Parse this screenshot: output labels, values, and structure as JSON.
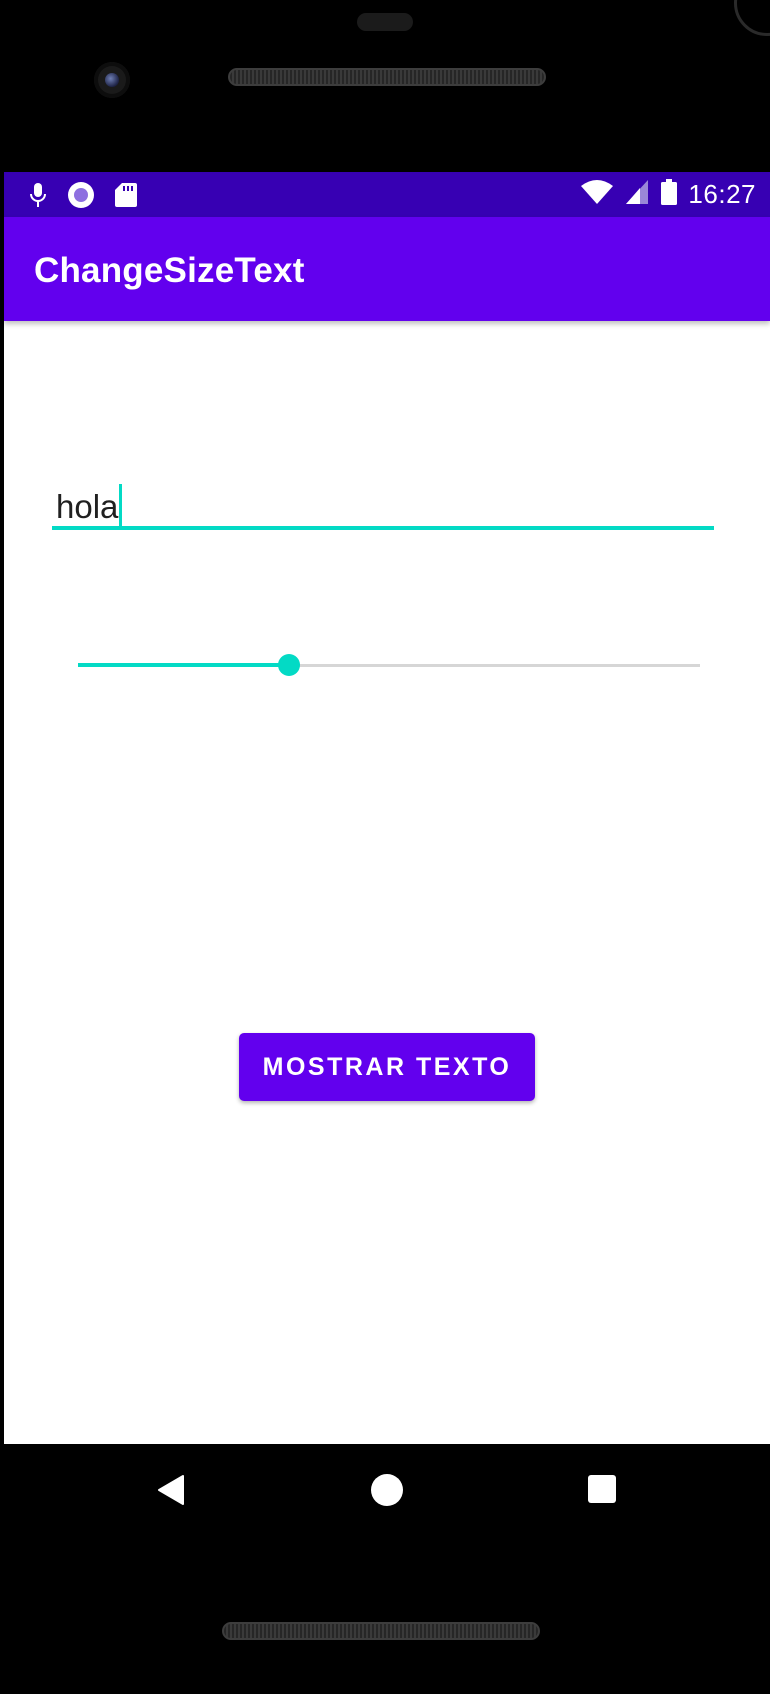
{
  "status_bar": {
    "time": "16:27",
    "left_icons": [
      "mic-icon",
      "record-icon",
      "sd-card-icon"
    ],
    "right_icons": [
      "wifi-icon",
      "signal-icon",
      "battery-icon"
    ]
  },
  "app_bar": {
    "title": "ChangeSizeText"
  },
  "text_field": {
    "value": "hola"
  },
  "seekbar": {
    "progress_fraction": 0.34
  },
  "button": {
    "label": "MOSTRAR TEXTO"
  },
  "colors": {
    "status_bar": "#3700B3",
    "primary": "#6200EE",
    "accent": "#03DAC5"
  },
  "nav_bar": {
    "icons": [
      "back-icon",
      "home-icon",
      "recents-icon"
    ]
  }
}
